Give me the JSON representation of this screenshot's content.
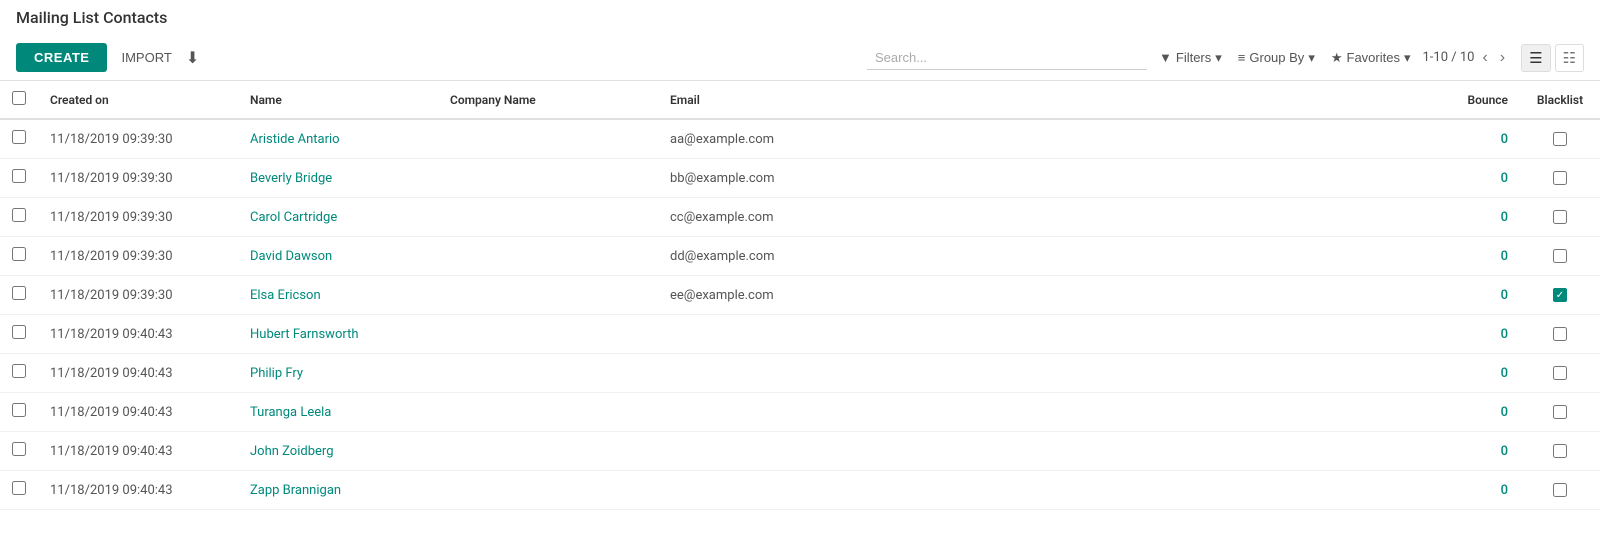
{
  "page": {
    "title": "Mailing List Contacts"
  },
  "toolbar": {
    "create_label": "CREATE",
    "import_label": "IMPORT",
    "search_placeholder": "Search..."
  },
  "filters": {
    "filters_label": "Filters",
    "groupby_label": "Group By",
    "favorites_label": "Favorites"
  },
  "pagination": {
    "current": "1-10 / 10"
  },
  "table": {
    "headers": [
      {
        "key": "created",
        "label": "Created on"
      },
      {
        "key": "name",
        "label": "Name"
      },
      {
        "key": "company",
        "label": "Company Name"
      },
      {
        "key": "email",
        "label": "Email"
      },
      {
        "key": "bounce",
        "label": "Bounce"
      },
      {
        "key": "blacklist",
        "label": "Blacklist"
      }
    ],
    "rows": [
      {
        "id": 1,
        "created": "11/18/2019 09:39:30",
        "name": "Aristide Antario",
        "company": "",
        "email": "aa@example.com",
        "bounce": 0,
        "blacklisted": false
      },
      {
        "id": 2,
        "created": "11/18/2019 09:39:30",
        "name": "Beverly Bridge",
        "company": "",
        "email": "bb@example.com",
        "bounce": 0,
        "blacklisted": false
      },
      {
        "id": 3,
        "created": "11/18/2019 09:39:30",
        "name": "Carol Cartridge",
        "company": "",
        "email": "cc@example.com",
        "bounce": 0,
        "blacklisted": false
      },
      {
        "id": 4,
        "created": "11/18/2019 09:39:30",
        "name": "David Dawson",
        "company": "",
        "email": "dd@example.com",
        "bounce": 0,
        "blacklisted": false
      },
      {
        "id": 5,
        "created": "11/18/2019 09:39:30",
        "name": "Elsa Ericson",
        "company": "",
        "email": "ee@example.com",
        "bounce": 0,
        "blacklisted": true
      },
      {
        "id": 6,
        "created": "11/18/2019 09:40:43",
        "name": "Hubert Farnsworth",
        "company": "",
        "email": "",
        "bounce": 0,
        "blacklisted": false
      },
      {
        "id": 7,
        "created": "11/18/2019 09:40:43",
        "name": "Philip Fry",
        "company": "",
        "email": "",
        "bounce": 0,
        "blacklisted": false
      },
      {
        "id": 8,
        "created": "11/18/2019 09:40:43",
        "name": "Turanga Leela",
        "company": "",
        "email": "",
        "bounce": 0,
        "blacklisted": false
      },
      {
        "id": 9,
        "created": "11/18/2019 09:40:43",
        "name": "John Zoidberg",
        "company": "",
        "email": "",
        "bounce": 0,
        "blacklisted": false
      },
      {
        "id": 10,
        "created": "11/18/2019 09:40:43",
        "name": "Zapp Brannigan",
        "company": "",
        "email": "",
        "bounce": 0,
        "blacklisted": false
      }
    ]
  }
}
